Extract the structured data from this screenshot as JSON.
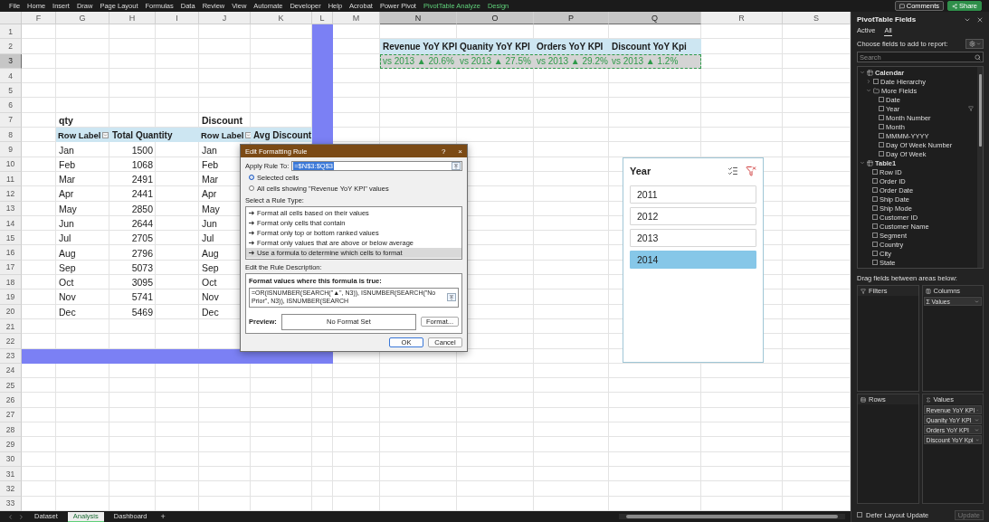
{
  "menu_bar": {
    "items": [
      {
        "label": "File",
        "kind": "standard"
      },
      {
        "label": "Home",
        "kind": "standard"
      },
      {
        "label": "Insert",
        "kind": "standard"
      },
      {
        "label": "Draw",
        "kind": "standard"
      },
      {
        "label": "Page Layout",
        "kind": "standard"
      },
      {
        "label": "Formulas",
        "kind": "standard"
      },
      {
        "label": "Data",
        "kind": "standard"
      },
      {
        "label": "Review",
        "kind": "standard"
      },
      {
        "label": "View",
        "kind": "standard"
      },
      {
        "label": "Automate",
        "kind": "standard"
      },
      {
        "label": "Developer",
        "kind": "standard"
      },
      {
        "label": "Help",
        "kind": "standard"
      },
      {
        "label": "Acrobat",
        "kind": "standard"
      },
      {
        "label": "Power Pivot",
        "kind": "standard"
      },
      {
        "label": "PivotTable Analyze",
        "kind": "contextual"
      },
      {
        "label": "Design",
        "kind": "contextual"
      }
    ],
    "comments_button": "Comments",
    "share_button": "Share"
  },
  "sheet": {
    "columns": [
      {
        "label": "F",
        "selected": false
      },
      {
        "label": "G",
        "selected": false
      },
      {
        "label": "H",
        "selected": false
      },
      {
        "label": "I",
        "selected": false
      },
      {
        "label": "J",
        "selected": false
      },
      {
        "label": "K",
        "selected": false
      },
      {
        "label": "L",
        "selected": false
      },
      {
        "label": "M",
        "selected": false
      },
      {
        "label": "N",
        "selected": true
      },
      {
        "label": "O",
        "selected": true
      },
      {
        "label": "P",
        "selected": true
      },
      {
        "label": "Q",
        "selected": true
      },
      {
        "label": "R",
        "selected": false
      },
      {
        "label": "S",
        "selected": false
      }
    ],
    "rows": [
      {
        "label": "1",
        "selected": false
      },
      {
        "label": "2",
        "selected": false
      },
      {
        "label": "3",
        "selected": true
      },
      {
        "label": "4",
        "selected": false
      },
      {
        "label": "5",
        "selected": false
      },
      {
        "label": "6",
        "selected": false
      },
      {
        "label": "7",
        "selected": false
      },
      {
        "label": "8",
        "selected": false
      },
      {
        "label": "9",
        "selected": false
      },
      {
        "label": "10",
        "selected": false
      },
      {
        "label": "11",
        "selected": false
      },
      {
        "label": "12",
        "selected": false
      },
      {
        "label": "13",
        "selected": false
      },
      {
        "label": "14",
        "selected": false
      },
      {
        "label": "15",
        "selected": false
      },
      {
        "label": "16",
        "selected": false
      },
      {
        "label": "17",
        "selected": false
      },
      {
        "label": "18",
        "selected": false
      },
      {
        "label": "19",
        "selected": false
      },
      {
        "label": "20",
        "selected": false
      },
      {
        "label": "21",
        "selected": false
      },
      {
        "label": "22",
        "selected": false
      },
      {
        "label": "23",
        "selected": false
      },
      {
        "label": "24",
        "selected": false
      },
      {
        "label": "25",
        "selected": false
      },
      {
        "label": "26",
        "selected": false
      },
      {
        "label": "27",
        "selected": false
      },
      {
        "label": "28",
        "selected": false
      },
      {
        "label": "29",
        "selected": false
      },
      {
        "label": "30",
        "selected": false
      },
      {
        "label": "31",
        "selected": false
      },
      {
        "label": "32",
        "selected": false
      },
      {
        "label": "33",
        "selected": false
      }
    ]
  },
  "kpi": {
    "headers": [
      "Revenue YoY KPI",
      "Quanity YoY KPI",
      "Orders YoY KPI",
      "Discount YoY Kpi"
    ],
    "values": [
      "vs 2013 ▲ 20.6%",
      "vs 2013 ▲ 27.5%",
      "vs 2013 ▲ 29.2%",
      "vs 2013 ▲ 1.2%"
    ]
  },
  "qty_pivot": {
    "title": "qty",
    "header": [
      "Row Label",
      "Total Quantity"
    ],
    "rows": [
      [
        "Jan",
        "1500"
      ],
      [
        "Feb",
        "1068"
      ],
      [
        "Mar",
        "2491"
      ],
      [
        "Apr",
        "2441"
      ],
      [
        "May",
        "2850"
      ],
      [
        "Jun",
        "2644"
      ],
      [
        "Jul",
        "2705"
      ],
      [
        "Aug",
        "2796"
      ],
      [
        "Sep",
        "5073"
      ],
      [
        "Oct",
        "3095"
      ],
      [
        "Nov",
        "5741"
      ],
      [
        "Dec",
        "5469"
      ]
    ]
  },
  "discount_pivot": {
    "title": "Discount",
    "header": [
      "Row Label",
      "Avg Discount"
    ],
    "months": [
      "Jan",
      "Feb",
      "Mar",
      "Apr",
      "May",
      "Jun",
      "Jul",
      "Aug",
      "Sep",
      "Oct",
      "Nov",
      "Dec"
    ]
  },
  "dialog": {
    "title": "Edit Formatting Rule",
    "help": "?",
    "close": "×",
    "apply_label": "Apply Rule To:",
    "apply_value": "=$N$3:$Q$3",
    "scope_options": [
      {
        "label": "Selected cells",
        "selected": true
      },
      {
        "label": "All cells showing \"Revenue YoY KPI\" values",
        "selected": false
      }
    ],
    "rule_type_label": "Select a Rule Type:",
    "rule_types": [
      {
        "label": "Format all cells based on their values",
        "selected": false
      },
      {
        "label": "Format only cells that contain",
        "selected": false
      },
      {
        "label": "Format only top or bottom ranked values",
        "selected": false
      },
      {
        "label": "Format only values that are above or below average",
        "selected": false
      },
      {
        "label": "Use a formula to determine which cells to format",
        "selected": true
      }
    ],
    "description_label": "Edit the Rule Description:",
    "formula_label": "Format values where this formula is true:",
    "formula": "=OR(ISNUMBER(SEARCH(\"▲\", N3)), ISNUMBER(SEARCH(\"No Prior\", N3)), ISNUMBER(SEARCH",
    "preview_label": "Preview:",
    "preview_text": "No Format Set",
    "format_button": "Format...",
    "ok_button": "OK",
    "cancel_button": "Cancel"
  },
  "slicer": {
    "title": "Year",
    "items": [
      {
        "label": "2011",
        "selected": false
      },
      {
        "label": "2012",
        "selected": false
      },
      {
        "label": "2013",
        "selected": false
      },
      {
        "label": "2014",
        "selected": true
      }
    ]
  },
  "sheet_tabs": {
    "tabs": [
      {
        "label": "Dataset",
        "selected": false
      },
      {
        "label": "Analysis",
        "selected": true
      },
      {
        "label": "Dashboard",
        "selected": false
      }
    ],
    "add": "+"
  },
  "pivot_fields": {
    "title": "PivotTable Fields",
    "tabs": [
      {
        "label": "Active",
        "selected": false
      },
      {
        "label": "All",
        "selected": true
      }
    ],
    "hint": "Choose fields to add to report:",
    "search": {
      "placeholder": "Search"
    },
    "fields": [
      {
        "label": "Calendar",
        "kind": "table",
        "expanded": true,
        "children": [
          {
            "label": "Date Hierarchy",
            "kind": "hierarchy",
            "expanded": false,
            "checked": false
          },
          {
            "label": "More Fields",
            "kind": "folder",
            "expanded": true,
            "children": [
              {
                "label": "Date",
                "kind": "field",
                "checked": false,
                "filtered": false
              },
              {
                "label": "Year",
                "kind": "field",
                "checked": false,
                "filtered": true
              },
              {
                "label": "Month Number",
                "kind": "field",
                "checked": false,
                "filtered": false
              },
              {
                "label": "Month",
                "kind": "field",
                "checked": false,
                "filtered": false
              },
              {
                "label": "MMMM-YYYY",
                "kind": "field",
                "checked": false,
                "filtered": false
              },
              {
                "label": "Day Of Week Number",
                "kind": "field",
                "checked": false,
                "filtered": false
              },
              {
                "label": "Day Of Week",
                "kind": "field",
                "checked": false,
                "filtered": false
              }
            ]
          }
        ]
      },
      {
        "label": "Table1",
        "kind": "table",
        "expanded": true,
        "children": [
          {
            "label": "Row ID",
            "kind": "field",
            "checked": false,
            "filtered": false
          },
          {
            "label": "Order ID",
            "kind": "field",
            "checked": false,
            "filtered": false
          },
          {
            "label": "Order Date",
            "kind": "field",
            "checked": false,
            "filtered": false
          },
          {
            "label": "Ship Date",
            "kind": "field",
            "checked": false,
            "filtered": false
          },
          {
            "label": "Ship Mode",
            "kind": "field",
            "checked": false,
            "filtered": false
          },
          {
            "label": "Customer ID",
            "kind": "field",
            "checked": false,
            "filtered": false
          },
          {
            "label": "Customer Name",
            "kind": "field",
            "checked": false,
            "filtered": false
          },
          {
            "label": "Segment",
            "kind": "field",
            "checked": false,
            "filtered": false
          },
          {
            "label": "Country",
            "kind": "field",
            "checked": false,
            "filtered": false
          },
          {
            "label": "City",
            "kind": "field",
            "checked": false,
            "filtered": false
          },
          {
            "label": "State",
            "kind": "field",
            "checked": false,
            "filtered": false
          }
        ]
      }
    ],
    "areas_hint": "Drag fields between areas below:",
    "areas": [
      {
        "label": "Filters",
        "kind": "filters"
      },
      {
        "label": "Columns",
        "kind": "columns",
        "items": [
          "Σ Values"
        ]
      },
      {
        "label": "Rows",
        "kind": "rows"
      },
      {
        "label": "Values",
        "kind": "values",
        "items": [
          "Revenue YoY KPI",
          "Quanity YoY KPI",
          "Orders YoY KPI",
          "Discount YoY Kpi"
        ]
      }
    ],
    "defer": {
      "label": "Defer Layout Update",
      "checked": false
    },
    "update_button": {
      "label": "Update",
      "disabled": true
    }
  }
}
